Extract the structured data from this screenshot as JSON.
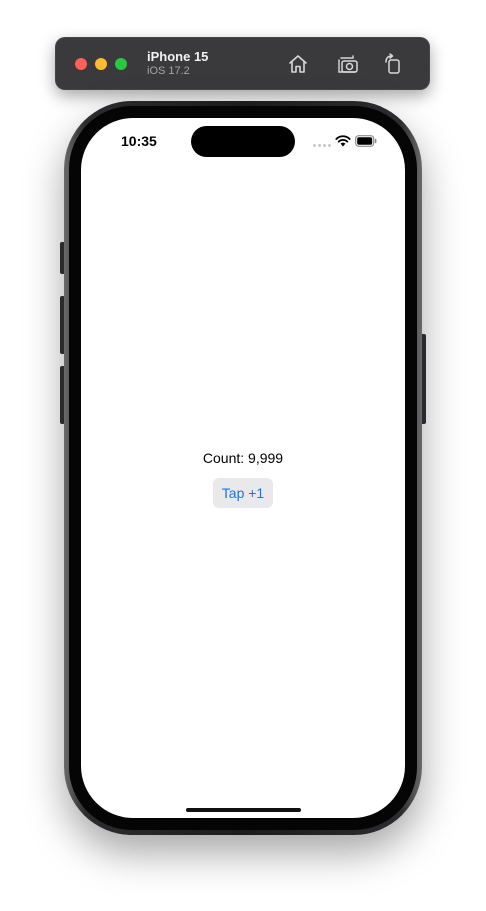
{
  "toolbar": {
    "device_name": "iPhone 15",
    "os_version": "iOS 17.2",
    "icons": [
      "home-icon",
      "screenshot-icon",
      "rotate-icon"
    ]
  },
  "status_bar": {
    "time": "10:35",
    "icons": [
      "cellular-dots-icon",
      "wifi-icon",
      "battery-icon"
    ]
  },
  "app": {
    "count_text": "Count: 9,999",
    "button_label": "Tap +1"
  },
  "colors": {
    "button_text": "#1a73e8",
    "button_bg": "#e9e9eb",
    "toolbar_bg": "#3a3a3c"
  }
}
